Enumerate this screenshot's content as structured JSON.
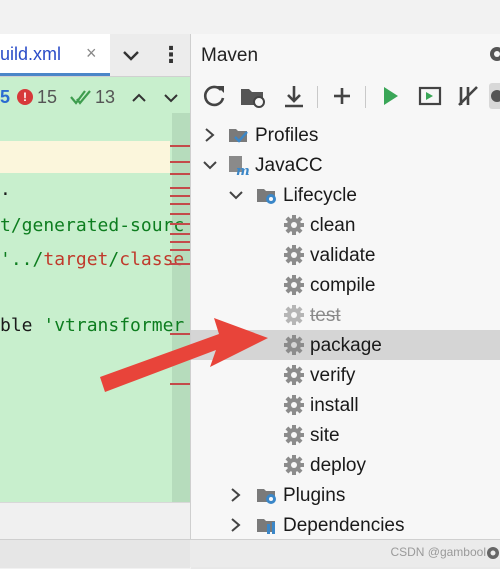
{
  "editor": {
    "tab_label": "uild.xml",
    "tab_close": "×",
    "more_label": "⋮",
    "inspections": {
      "warnings": "5",
      "errors": "15",
      "checks": "13"
    },
    "lines": {
      "line3": ".",
      "line4_str": "t/generated-sourc",
      "line5_str": "'../",
      "line5_red": "target",
      "line5_slash": "/",
      "line5_red2": "classe",
      "line7_plain": "ble ",
      "line7_str": "'vtransformer"
    }
  },
  "maven": {
    "title": "Maven",
    "tree": {
      "profiles": "Profiles",
      "project": "JavaCC",
      "lifecycle": "Lifecycle",
      "goals": [
        "clean",
        "validate",
        "compile",
        "test",
        "package",
        "verify",
        "install",
        "site",
        "deploy"
      ],
      "plugins": "Plugins",
      "dependencies": "Dependencies"
    },
    "selected_goal": "package",
    "disabled_goal": "test"
  },
  "footer": {
    "watermark": "CSDN @gambool"
  },
  "colors": {
    "editor_bg": "#c8efcd",
    "selection_bg": "#d5d5d5",
    "arrow": "#e8443a",
    "run_green": "#3aa657"
  }
}
